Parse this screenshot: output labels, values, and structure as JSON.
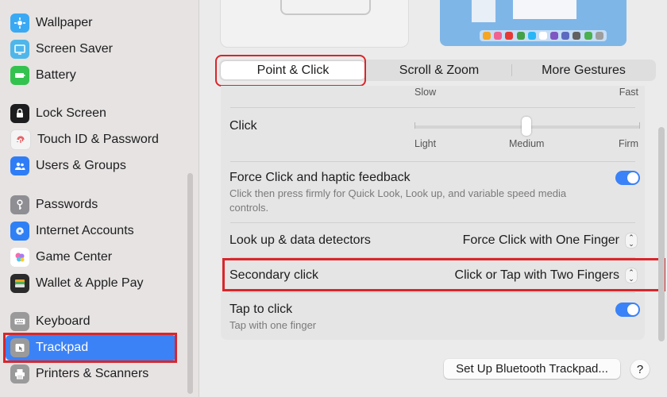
{
  "sidebar": {
    "items": [
      {
        "label": "Wallpaper",
        "icon": "wallpaper-icon",
        "color": "#3aa9f4"
      },
      {
        "label": "Screen Saver",
        "icon": "screen-saver-icon",
        "color": "#4fb6ea"
      },
      {
        "label": "Battery",
        "icon": "battery-icon",
        "color": "#33c24d"
      },
      {
        "label": "Lock Screen",
        "icon": "lock-icon",
        "color": "#1d1d1f"
      },
      {
        "label": "Touch ID & Password",
        "icon": "fingerprint-icon",
        "color": "#f4f4f4"
      },
      {
        "label": "Users & Groups",
        "icon": "users-icon",
        "color": "#2f7df6"
      },
      {
        "label": "Passwords",
        "icon": "key-icon",
        "color": "#8e8e93"
      },
      {
        "label": "Internet Accounts",
        "icon": "at-icon",
        "color": "#2f80f5"
      },
      {
        "label": "Game Center",
        "icon": "game-center-icon",
        "color": "#ffffff"
      },
      {
        "label": "Wallet & Apple Pay",
        "icon": "wallet-icon",
        "color": "#2b2b2b"
      },
      {
        "label": "Keyboard",
        "icon": "keyboard-icon",
        "color": "#9a9a9a"
      },
      {
        "label": "Trackpad",
        "icon": "trackpad-icon",
        "color": "#9a9a9a",
        "selected": true
      },
      {
        "label": "Printers & Scanners",
        "icon": "printer-icon",
        "color": "#9a9a9a"
      }
    ]
  },
  "tabs": {
    "point_click": "Point & Click",
    "scroll_zoom": "Scroll & Zoom",
    "more_gestures": "More Gestures"
  },
  "tracking": {
    "slow": "Slow",
    "fast": "Fast"
  },
  "click": {
    "title": "Click",
    "light": "Light",
    "medium": "Medium",
    "firm": "Firm",
    "level": 0.5
  },
  "force_click": {
    "title": "Force Click and haptic feedback",
    "subtitle": "Click then press firmly for Quick Look, Look up, and variable speed media controls.",
    "enabled": true
  },
  "look_up": {
    "title": "Look up & data detectors",
    "value": "Force Click with One Finger"
  },
  "secondary_click": {
    "title": "Secondary click",
    "value": "Click or Tap with Two Fingers"
  },
  "tap_to_click": {
    "title": "Tap to click",
    "subtitle": "Tap with one finger",
    "enabled": true
  },
  "buttons": {
    "bluetooth": "Set Up Bluetooth Trackpad...",
    "help": "?"
  },
  "colors": {
    "accent": "#3b82f6",
    "highlight": "#d9262b",
    "toggle_on": "#3a82f7"
  }
}
